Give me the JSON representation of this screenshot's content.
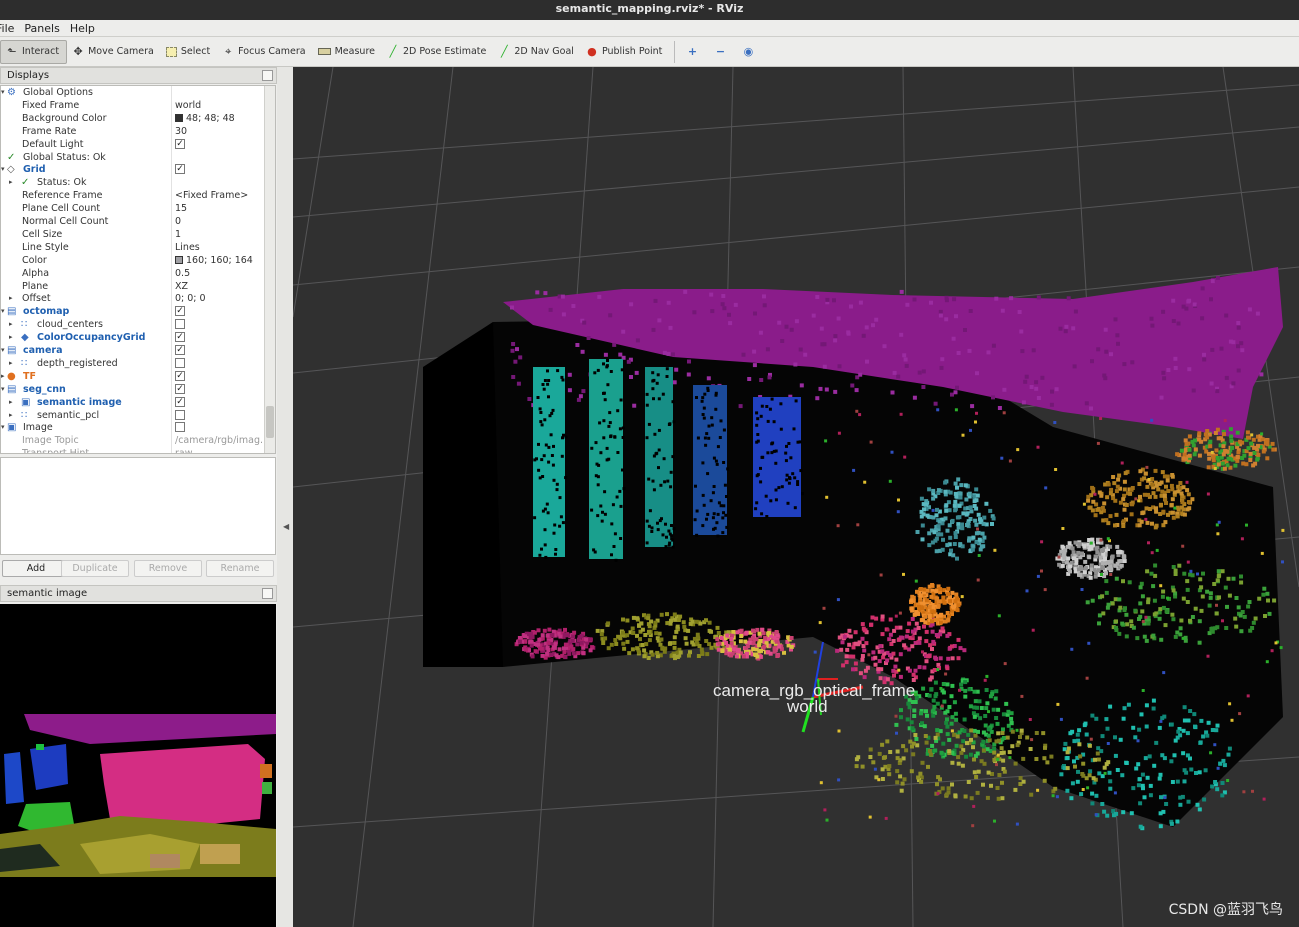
{
  "window": {
    "title": "semantic_mapping.rviz* - RViz"
  },
  "menu": [
    "File",
    "Panels",
    "Help"
  ],
  "toolbar": {
    "tools": [
      {
        "label": "Interact",
        "icon": "cursor-icon",
        "active": true
      },
      {
        "label": "Move Camera",
        "icon": "move-camera-icon",
        "active": false
      },
      {
        "label": "Select",
        "icon": "select-icon",
        "active": false
      },
      {
        "label": "Focus Camera",
        "icon": "focus-camera-icon",
        "active": false
      },
      {
        "label": "Measure",
        "icon": "measure-icon",
        "active": false
      },
      {
        "label": "2D Pose Estimate",
        "icon": "pose-estimate-icon",
        "active": false
      },
      {
        "label": "2D Nav Goal",
        "icon": "nav-goal-icon",
        "active": false
      },
      {
        "label": "Publish Point",
        "icon": "publish-point-icon",
        "active": false
      }
    ]
  },
  "displays": {
    "header": "Displays",
    "rows": [
      {
        "label": "Global Options",
        "value": "",
        "indent": 1,
        "kind": "gear",
        "arrow": "open",
        "style": ""
      },
      {
        "label": "Fixed Frame",
        "value": "world",
        "indent": 2,
        "kind": "",
        "arrow": "",
        "style": ""
      },
      {
        "label": "Background Color",
        "value": "48; 48; 48",
        "swatch": "#303030",
        "indent": 2,
        "kind": "",
        "arrow": "",
        "style": ""
      },
      {
        "label": "Frame Rate",
        "value": "30",
        "indent": 2,
        "kind": "",
        "arrow": "",
        "style": ""
      },
      {
        "label": "Default Light",
        "value": "",
        "check": true,
        "indent": 2,
        "kind": "",
        "arrow": "",
        "style": ""
      },
      {
        "label": "Global Status: Ok",
        "value": "",
        "indent": 1,
        "kind": "ok",
        "arrow": "",
        "style": ""
      },
      {
        "label": "Grid",
        "value": "",
        "check": true,
        "indent": 1,
        "kind": "grid",
        "arrow": "open",
        "style": "blue"
      },
      {
        "label": "Status: Ok",
        "value": "",
        "indent": 2,
        "kind": "ok",
        "arrow": "closed",
        "style": ""
      },
      {
        "label": "Reference Frame",
        "value": "<Fixed Frame>",
        "indent": 2,
        "kind": "",
        "arrow": "",
        "style": ""
      },
      {
        "label": "Plane Cell Count",
        "value": "15",
        "indent": 2,
        "kind": "",
        "arrow": "",
        "style": ""
      },
      {
        "label": "Normal Cell Count",
        "value": "0",
        "indent": 2,
        "kind": "",
        "arrow": "",
        "style": ""
      },
      {
        "label": "Cell Size",
        "value": "1",
        "indent": 2,
        "kind": "",
        "arrow": "",
        "style": ""
      },
      {
        "label": "Line Style",
        "value": "Lines",
        "indent": 2,
        "kind": "",
        "arrow": "",
        "style": ""
      },
      {
        "label": "Color",
        "value": "160; 160; 164",
        "swatch": "#a0a0a4",
        "indent": 2,
        "kind": "",
        "arrow": "",
        "style": ""
      },
      {
        "label": "Alpha",
        "value": "0.5",
        "indent": 2,
        "kind": "",
        "arrow": "",
        "style": ""
      },
      {
        "label": "Plane",
        "value": "XZ",
        "indent": 2,
        "kind": "",
        "arrow": "",
        "style": ""
      },
      {
        "label": "Offset",
        "value": "0; 0; 0",
        "indent": 2,
        "kind": "",
        "arrow": "closed",
        "style": ""
      },
      {
        "label": "octomap",
        "value": "",
        "check": true,
        "indent": 1,
        "kind": "folder",
        "arrow": "open",
        "style": "blue"
      },
      {
        "label": "cloud_centers",
        "value": "",
        "check": false,
        "indent": 2,
        "kind": "cloud",
        "arrow": "closed",
        "style": ""
      },
      {
        "label": "ColorOccupancyGrid",
        "value": "",
        "check": true,
        "indent": 2,
        "kind": "cube",
        "arrow": "closed",
        "style": "blue"
      },
      {
        "label": "camera",
        "value": "",
        "check": true,
        "indent": 1,
        "kind": "folder",
        "arrow": "open",
        "style": "blue"
      },
      {
        "label": "depth_registered",
        "value": "",
        "check": false,
        "indent": 2,
        "kind": "cloud",
        "arrow": "closed",
        "style": ""
      },
      {
        "label": "TF",
        "value": "",
        "check": true,
        "indent": 1,
        "kind": "warn",
        "arrow": "closed",
        "style": "orange"
      },
      {
        "label": "seg_cnn",
        "value": "",
        "check": true,
        "indent": 1,
        "kind": "folder",
        "arrow": "open",
        "style": "blue"
      },
      {
        "label": "semantic image",
        "value": "",
        "check": true,
        "indent": 2,
        "kind": "image",
        "arrow": "closed",
        "style": "blue"
      },
      {
        "label": "semantic_pcl",
        "value": "",
        "check": false,
        "indent": 2,
        "kind": "cloud",
        "arrow": "closed",
        "style": ""
      },
      {
        "label": "Image",
        "value": "",
        "check": false,
        "indent": 1,
        "kind": "image",
        "arrow": "open",
        "style": ""
      },
      {
        "label": "Image Topic",
        "value": "/camera/rgb/imag...",
        "indent": 2,
        "kind": "",
        "arrow": "",
        "style": "grey"
      },
      {
        "label": "Transport Hint",
        "value": "raw",
        "indent": 2,
        "kind": "",
        "arrow": "",
        "style": "grey"
      }
    ],
    "buttons": {
      "add": "Add",
      "duplicate": "Duplicate",
      "remove": "Remove",
      "rename": "Rename"
    }
  },
  "semantic_panel": {
    "header": "semantic image"
  },
  "viewport": {
    "background": "#303030",
    "frame_labels": {
      "camera": "camera_rgb_optical_frame",
      "world": "world"
    },
    "watermark": "CSDN @蓝羽飞鸟"
  },
  "colors": {
    "accent_blue": "#2060b0",
    "tf_orange": "#e07020",
    "ok_green": "#2a8a2a"
  }
}
